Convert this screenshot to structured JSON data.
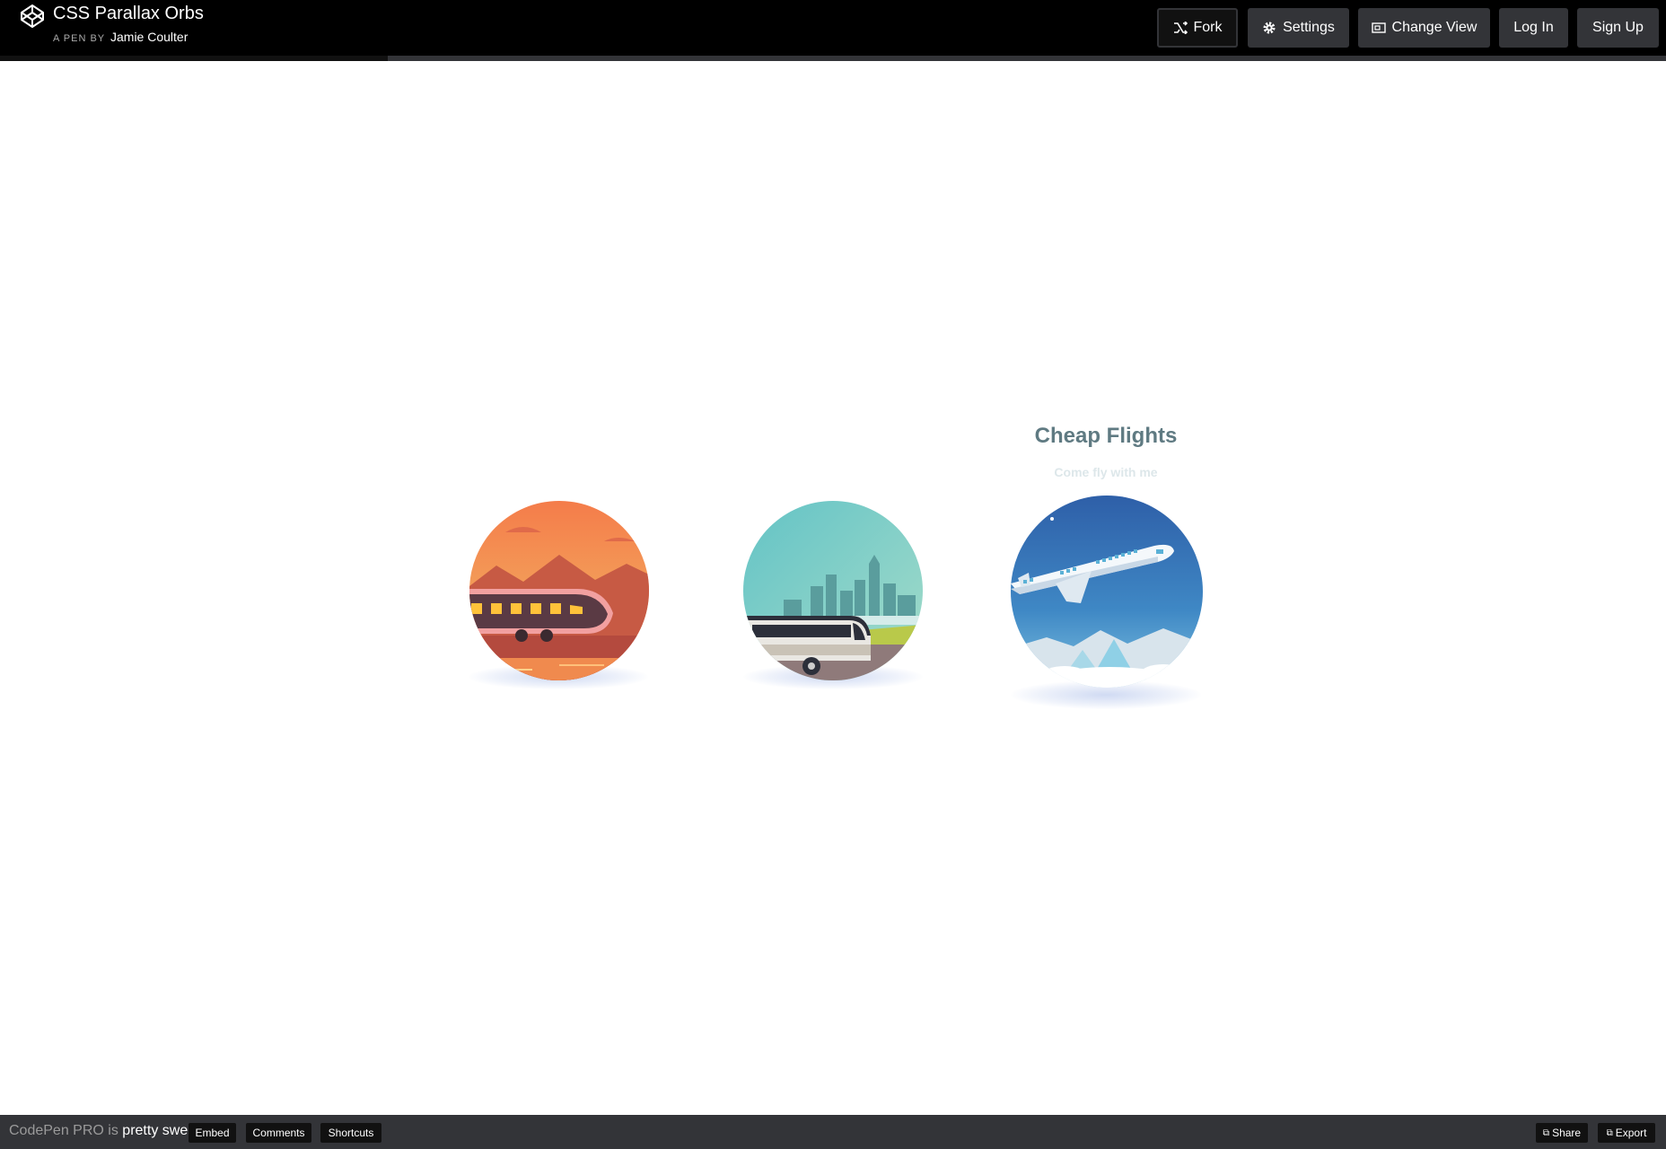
{
  "header": {
    "title": "CSS Parallax Orbs",
    "byline_prefix": "A PEN BY",
    "author": "Jamie Coulter",
    "buttons": {
      "fork": "Fork",
      "settings": "Settings",
      "change_view": "Change View",
      "login": "Log In",
      "signup": "Sign Up"
    }
  },
  "stage": {
    "active_orb_title": "Cheap Flights",
    "active_orb_subtitle": "Come fly with me",
    "orbs": [
      {
        "scene": "train",
        "icon": "train-icon"
      },
      {
        "scene": "bus",
        "icon": "bus-icon"
      },
      {
        "scene": "plane",
        "icon": "airplane-icon"
      }
    ]
  },
  "footer": {
    "promo_prefix": "CodePen PRO is",
    "promo_emphasis": "pretty sweet.",
    "buttons": {
      "embed": "Embed",
      "comments": "Comments",
      "shortcuts": "Shortcuts",
      "share": "Share",
      "export": "Export"
    }
  },
  "colors": {
    "header_bg": "#000000",
    "button_bg": "#333438",
    "heading": "#5f7a82"
  }
}
